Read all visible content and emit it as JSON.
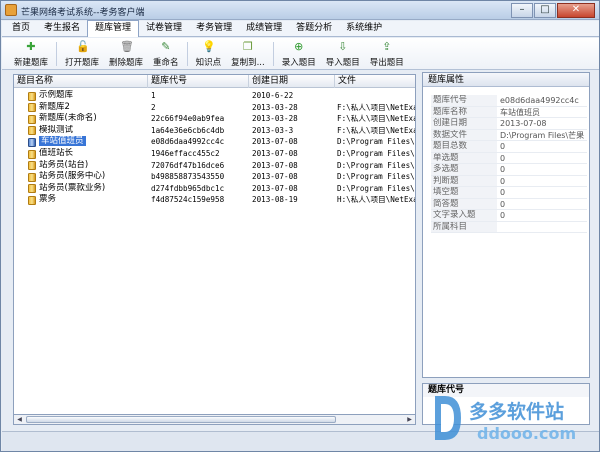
{
  "window": {
    "title": "芒果网络考试系统--考务客户端"
  },
  "menu": [
    {
      "label": "首页",
      "active": false
    },
    {
      "label": "考生报名",
      "active": false
    },
    {
      "label": "题库管理",
      "active": true
    },
    {
      "label": "试卷管理",
      "active": false
    },
    {
      "label": "考务管理",
      "active": false
    },
    {
      "label": "成绩管理",
      "active": false
    },
    {
      "label": "答题分析",
      "active": false
    },
    {
      "label": "系统维护",
      "active": false
    }
  ],
  "toolbar": [
    {
      "label": "新建题库",
      "icon": "plus-icon",
      "color": "#3aa43a"
    },
    {
      "label": "打开题库",
      "icon": "lock-icon",
      "color": "#d69a1e"
    },
    {
      "label": "删除题库",
      "icon": "trash-icon",
      "color": "#777777"
    },
    {
      "label": "重命名",
      "icon": "pencil-icon",
      "color": "#3d8a3d"
    },
    {
      "label": "知识点",
      "icon": "bulb-icon",
      "color": "#e2b62c"
    },
    {
      "label": "复制到...",
      "icon": "copy-icon",
      "color": "#6a9a3a"
    },
    {
      "label": "录入题目",
      "icon": "add-circle-icon",
      "color": "#2f9a2f"
    },
    {
      "label": "导入题目",
      "icon": "import-icon",
      "color": "#3a8a3a"
    },
    {
      "label": "导出题目",
      "icon": "export-icon",
      "color": "#3a8a3a"
    }
  ],
  "table": {
    "columns": [
      "题目名称",
      "题库代号",
      "创建日期",
      "文件"
    ],
    "rows": [
      {
        "name": "示例题库",
        "code": "1",
        "date": "2010-6-22",
        "file": ""
      },
      {
        "name": "新题库2",
        "code": "2",
        "date": "2013-03-28",
        "file": "F:\\私人\\项目\\NetExa"
      },
      {
        "name": "新题库(未命名)",
        "code": "22c66f94e0ab9fea",
        "date": "2013-03-28",
        "file": "F:\\私人\\项目\\NetExa"
      },
      {
        "name": "模拟测试",
        "code": "1a64e36e6cb6c4db",
        "date": "2013-03-3",
        "file": "F:\\私人\\项目\\NetExa"
      },
      {
        "name": "车站值班员",
        "code": "e08d6daa4992cc4c",
        "date": "2013-07-08",
        "file": "D:\\Program Files\\芒",
        "selected": true
      },
      {
        "name": "值班站长",
        "code": "1946effacc455c2",
        "date": "2013-07-08",
        "file": "D:\\Program Files\\芒"
      },
      {
        "name": "站务员(站台)",
        "code": "72076df47b16dce6",
        "date": "2013-07-08",
        "file": "D:\\Program Files\\芒"
      },
      {
        "name": "站务员(服务中心)",
        "code": "b498858873543550",
        "date": "2013-07-08",
        "file": "D:\\Program Files\\芒"
      },
      {
        "name": "站务员(票款业务)",
        "code": "d274fdbb965dbc1c",
        "date": "2013-07-08",
        "file": "D:\\Program Files\\芒"
      },
      {
        "name": "票务",
        "code": "f4d87524c159e958",
        "date": "2013-08-19",
        "file": "H:\\私人\\项目\\NetExa"
      }
    ]
  },
  "properties": {
    "title": "题库属性",
    "items": [
      {
        "key": "题库代号",
        "value": "e08d6daa4992cc4c"
      },
      {
        "key": "题库名称",
        "value": "车站值班员"
      },
      {
        "key": "创建日期",
        "value": "2013-07-08"
      },
      {
        "key": "数据文件",
        "value": "D:\\Program Files\\芒果"
      },
      {
        "key": "题目总数",
        "value": "0"
      },
      {
        "key": "单选题",
        "value": "0"
      },
      {
        "key": "多选题",
        "value": "0"
      },
      {
        "key": "判断题",
        "value": "0"
      },
      {
        "key": "填空题",
        "value": "0"
      },
      {
        "key": "简答题",
        "value": "0"
      },
      {
        "key": "文字录入题",
        "value": "0"
      },
      {
        "key": "所属科目",
        "value": ""
      }
    ]
  },
  "description": {
    "title": "题库代号"
  },
  "watermark": {
    "main": "多多软件站",
    "sub": "ddooo.com"
  }
}
